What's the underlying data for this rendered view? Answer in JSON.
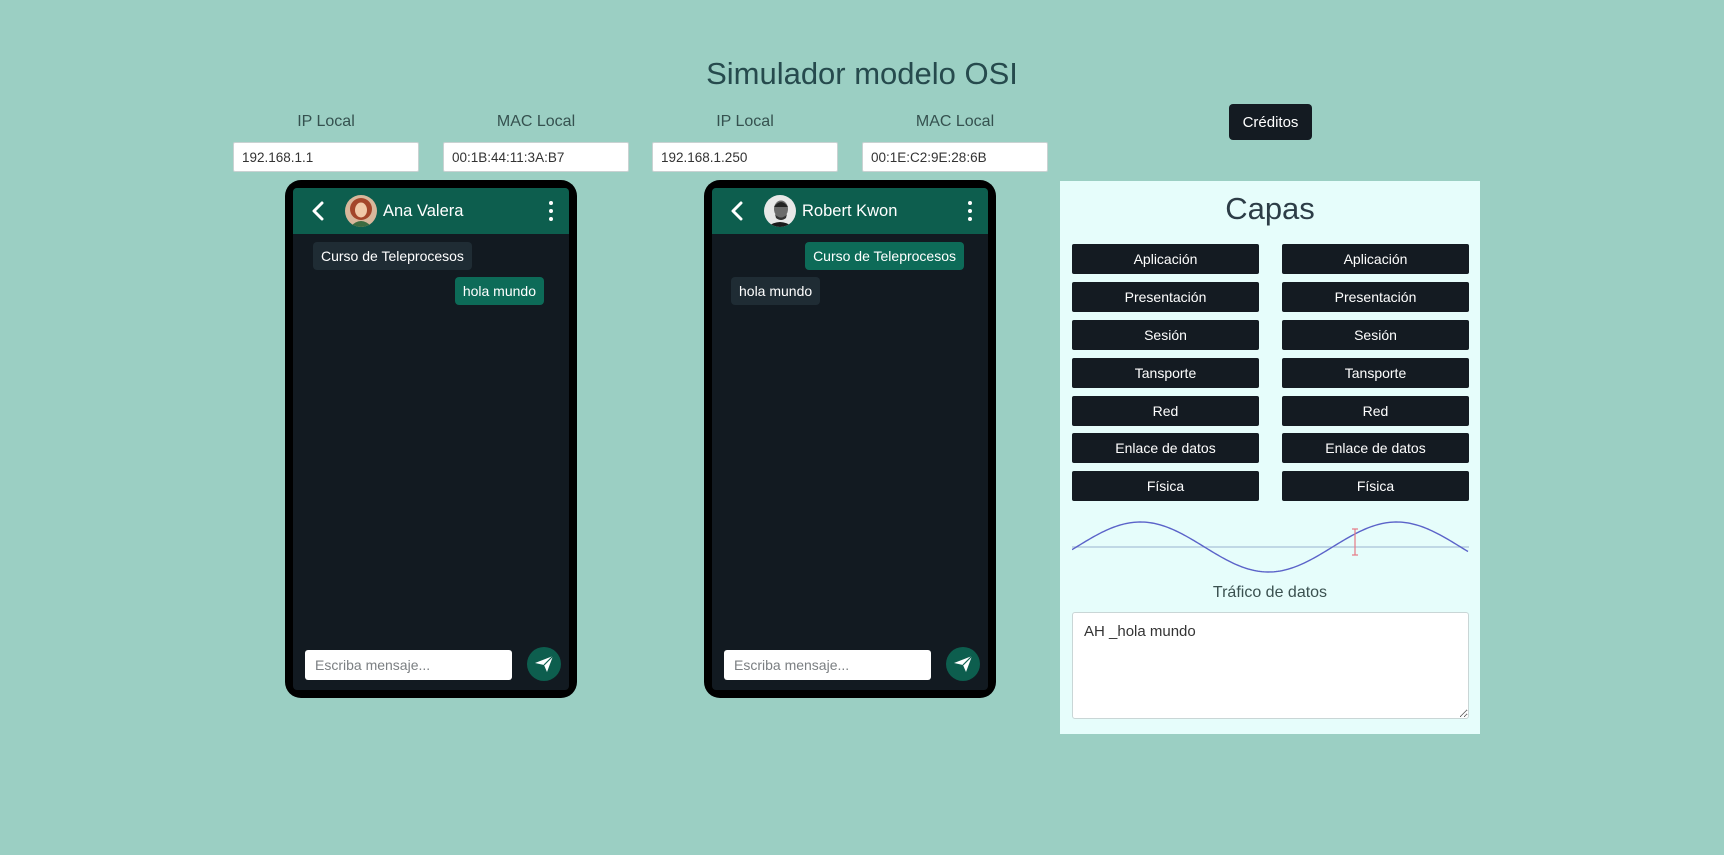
{
  "page": {
    "title": "Simulador modelo OSI"
  },
  "fields": [
    {
      "label": "IP Local",
      "value": "192.168.1.1"
    },
    {
      "label": "MAC Local",
      "value": "00:1B:44:11:3A:B7"
    },
    {
      "label": "IP Local",
      "value": "192.168.1.250"
    },
    {
      "label": "MAC Local",
      "value": "00:1E:C2:9E:28:6B"
    }
  ],
  "credits_label": "Créditos",
  "phones": [
    {
      "contact": "Ana Valera",
      "messages": [
        {
          "text": "Curso de Teleprocesos",
          "direction": "in"
        },
        {
          "text": "hola mundo",
          "direction": "out"
        }
      ],
      "composer_placeholder": "Escriba mensaje..."
    },
    {
      "contact": "Robert Kwon",
      "messages": [
        {
          "text": "Curso de Teleprocesos",
          "direction": "out"
        },
        {
          "text": "hola mundo",
          "direction": "in"
        }
      ],
      "composer_placeholder": "Escriba mensaje..."
    }
  ],
  "layers": {
    "title": "Capas",
    "left": [
      "Aplicación",
      "Presentación",
      "Sesión",
      "Tansporte",
      "Red",
      "Enlace de datos",
      "Física"
    ],
    "right": [
      "Aplicación",
      "Presentación",
      "Sesión",
      "Tansporte",
      "Red",
      "Enlace de datos",
      "Física"
    ],
    "traffic_label": "Tráfico de datos",
    "traffic_text": "AH _hola mundo"
  },
  "colors": {
    "background": "#9bcfc3",
    "header_green": "#0d5e4e",
    "button_dark": "#141b22",
    "wave": "#5b63c9"
  },
  "icons": [
    "chevron-left-icon",
    "kebab-menu-icon",
    "send-icon",
    "avatar"
  ]
}
